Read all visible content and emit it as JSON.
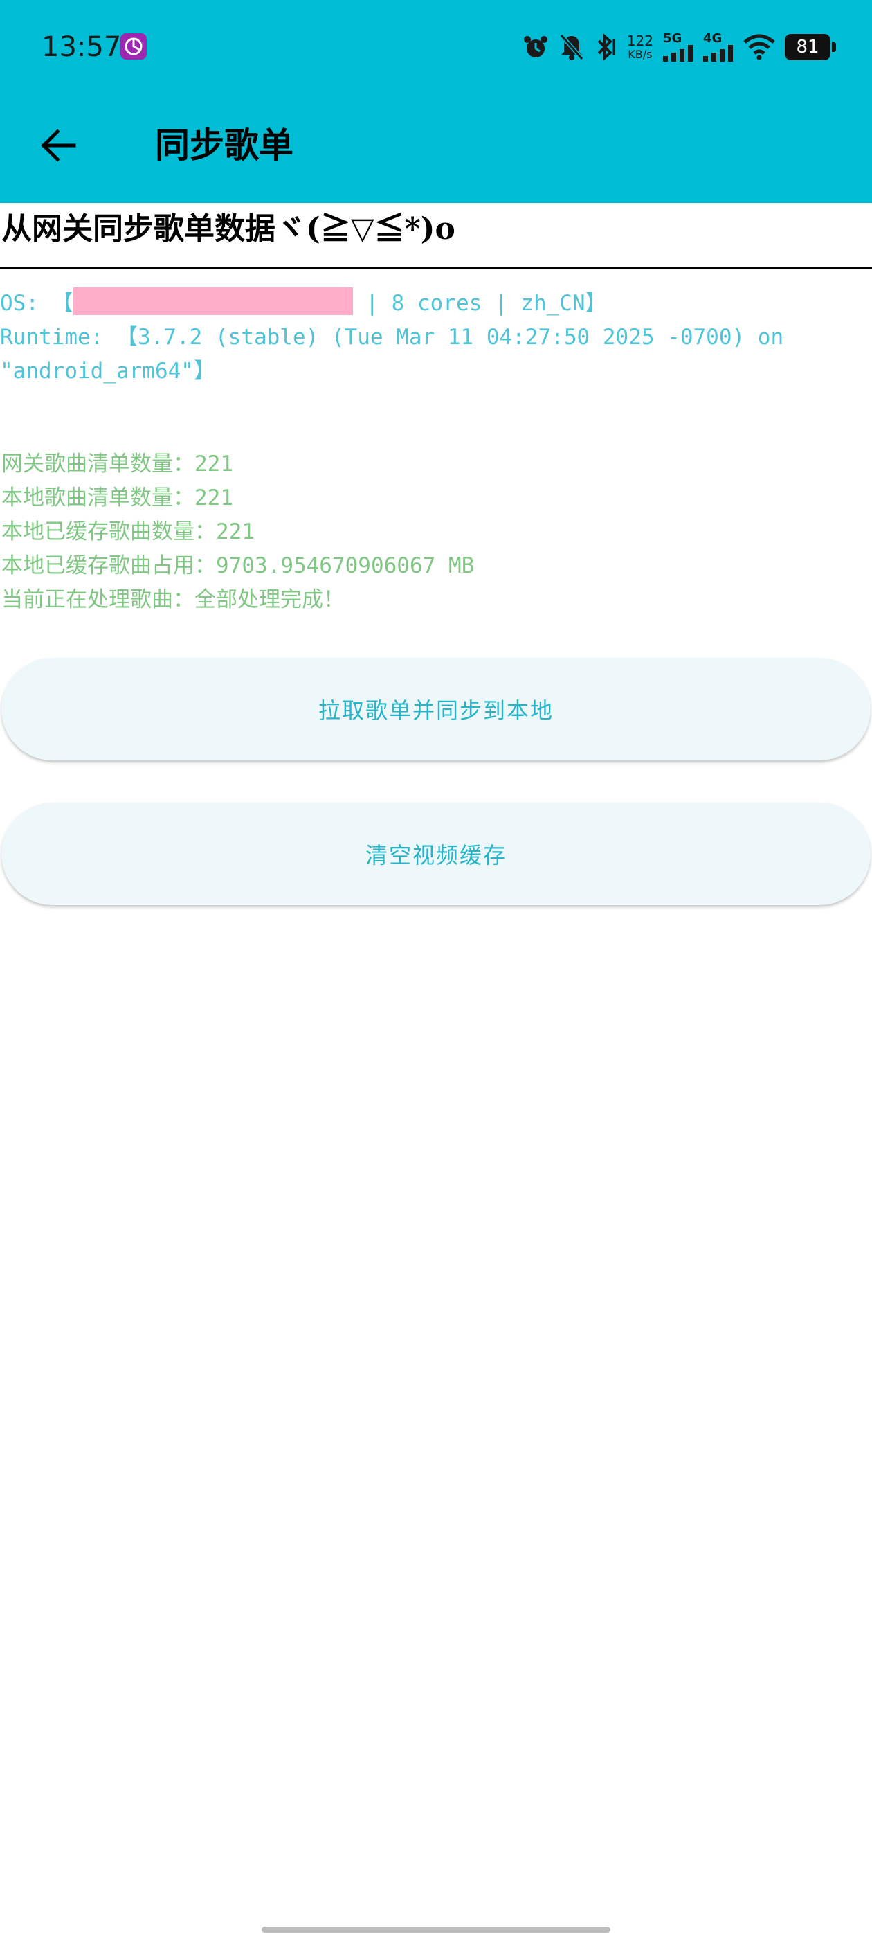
{
  "status_bar": {
    "time": "13:57",
    "net_speed_value": "122",
    "net_speed_unit": "KB/s",
    "sim1_tag": "5G",
    "sim2_tag": "4G",
    "battery": "81"
  },
  "app_bar": {
    "title": "同步歌单",
    "background": "#00BCD4"
  },
  "headline": "从网关同步歌单数据ヾ(≧▽≦*)o",
  "system_info": {
    "os_prefix": "OS: 【",
    "os_suffix": " | 8 cores | zh_CN】",
    "runtime_line1": "Runtime: 【3.7.2 (stable) (Tue Mar 11 04:27:50 2025 -0700) on",
    "runtime_line2": "\"android_arm64\"】"
  },
  "stats": {
    "gateway_count": "网关歌曲清单数量：221",
    "local_count": "本地歌曲清单数量：221",
    "cached_count": "本地已缓存歌曲数量：221",
    "cached_size": "本地已缓存歌曲占用：9703.954670906067 MB",
    "processing": "当前正在处理歌曲：全部处理完成！"
  },
  "buttons": {
    "sync": "拉取歌单并同步到本地",
    "clear_cache": "清空视频缓存"
  },
  "colors": {
    "accent": "#00BCD4",
    "info_text": "#4fc3d7",
    "stats_text": "#81c784",
    "button_bg": "#eef8fa",
    "button_text": "#26b4c9",
    "redaction": "#ffadc8"
  }
}
